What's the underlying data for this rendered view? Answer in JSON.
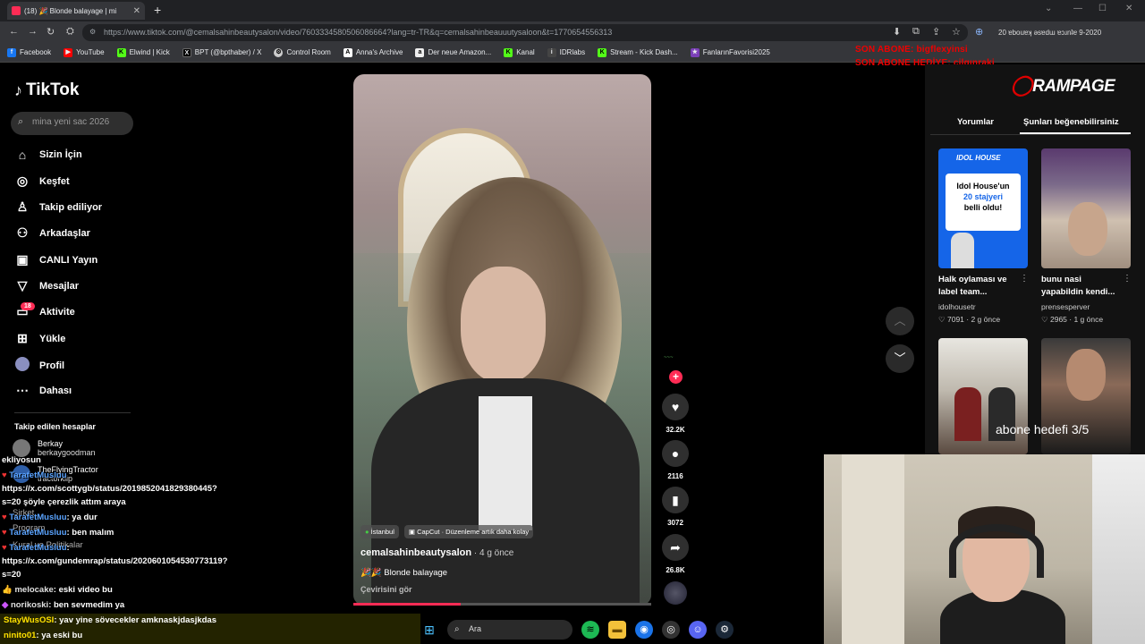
{
  "browser": {
    "tab_title": "(18) 🎉 Blonde balayage | mi",
    "url": "https://www.tiktok.com/@cemalsahinbeautysalon/video/7603334580506086664?lang=tr-TR&q=cemalsahinbeauuutysaloon&t=1770654556313",
    "bookmarks": [
      "Facebook",
      "YouTube",
      "Elwind | Kick",
      "BPT (@bpthaber) / X",
      "Control Room",
      "Anna's Archive",
      "Der neue Amazon...",
      "Kanal",
      "IDRlabs",
      "Stream - Kick Dash...",
      "FanlarınFavorisi2025"
    ],
    "ext_text": "20 ɐbouɐʞ ǝsɐdɯ ɐɔɹnʇɐ 9-2020"
  },
  "overlay": {
    "son_abone_1": "SON ABONE: bigflexyinsi",
    "son_abone_2": "SON ABONE HEDİYE: cilgınraki",
    "rampage": "RAMPAGE",
    "abone_hedefi": "abone hedefi 3/5"
  },
  "tiktok": {
    "logo": "TikTok",
    "search_placeholder": "mina yeni sac 2026",
    "nav": [
      "Sizin İçin",
      "Keşfet",
      "Takip ediliyor",
      "Arkadaşlar",
      "CANLI Yayın",
      "Mesajlar",
      "Aktivite",
      "Yükle",
      "Profil",
      "Dahası"
    ],
    "activity_badge": "18",
    "followed_header": "Takip edilen hesaplar",
    "accounts": [
      {
        "name": "Berkay",
        "handle": "berkaygoodman"
      },
      {
        "name": "TheFlyingTractor",
        "handle": "tractorklip"
      }
    ]
  },
  "chat": [
    {
      "text": "ekliyosun"
    },
    {
      "user": "TarafetMusluu",
      "text": ""
    },
    {
      "text": "https://x.com/scottygb/status/2019852041829380445?"
    },
    {
      "text": "s=20 şöyle çerezlik attım araya"
    },
    {
      "text": "Şirket"
    },
    {
      "user": "TarafetMusluu",
      "text": ": ya dur"
    },
    {
      "text": "Program"
    },
    {
      "user": "TarafetMusluu",
      "text": ": ben malım"
    },
    {
      "text": "Kural ve Politikalar"
    },
    {
      "user": "TarafetMusluu",
      "text": ":"
    },
    {
      "text": "https://x.com/gundemrap/status/2020601054530773119?"
    },
    {
      "text": "s=20"
    },
    {
      "user": "melocake",
      "text": ": eski video bu"
    },
    {
      "user": "norikoski",
      "text": ": ben sevmedim ya"
    }
  ],
  "chat_yellow": [
    {
      "user": "StayWusOSI",
      "text": ": yav yine sövecekler amknaskjdasjkdas"
    },
    {
      "user": "ninito01",
      "text": ": ya eski bu"
    }
  ],
  "video": {
    "tag_location": "İstanbul",
    "tag_capcut": "CapCut · Düzenleme artık daha kolay",
    "author": "cemalsahinbeautysalon",
    "age": " · 4 g önce",
    "desc": "🎉🎉 Blonde balayage",
    "translate": "Çevirisini gör",
    "progress": 0.36,
    "likes": "32.2K",
    "comments": "2116",
    "saves": "3072",
    "shares": "26.8K"
  },
  "right": {
    "tab_comments": "Yorumlar",
    "tab_like": "Şunları beğenebilirsiniz",
    "cards": [
      {
        "title": "Halk oylaması ve\nlabel team...",
        "user": "idolhousetr",
        "likes": "7091",
        "age": "2 g önce",
        "thumb_text_1": "IDOL HOUSE",
        "thumb_text_2": "Idol House'un",
        "thumb_text_3": "20 stajyeri",
        "thumb_text_4": "belli oldu!"
      },
      {
        "title": "bunu nasi\nyapabildin kendi...",
        "user": "prensesperver",
        "likes": "2965",
        "age": "1 g önce"
      }
    ]
  },
  "taskbar": {
    "search": "Ara"
  },
  "colors": {
    "accent": "#fe2c55",
    "chat_user": "#5aa3ff",
    "chat_yellow": "#ffe100",
    "overlay_red": "#e00000"
  }
}
